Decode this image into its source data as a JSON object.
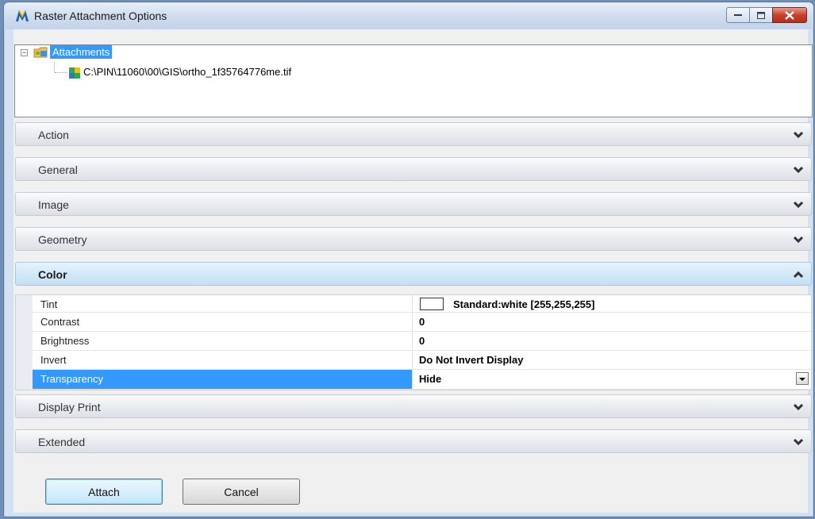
{
  "window": {
    "title": "Raster Attachment Options"
  },
  "tree": {
    "root_label": "Attachments",
    "expander": "−",
    "file_label": "C:\\PIN\\11060\\00\\GIS\\ortho_1f35764776me.tif"
  },
  "panels": {
    "action": "Action",
    "general": "General",
    "image": "Image",
    "geometry": "Geometry",
    "color": "Color",
    "display_print": "Display Print",
    "extended": "Extended"
  },
  "color_properties": [
    {
      "name": "Tint",
      "value": "Standard:white [255,255,255]"
    },
    {
      "name": "Contrast",
      "value": "0"
    },
    {
      "name": "Brightness",
      "value": "0"
    },
    {
      "name": "Invert",
      "value": "Do Not Invert Display"
    },
    {
      "name": "Transparency",
      "value": "Hide"
    }
  ],
  "buttons": {
    "attach": "Attach",
    "cancel": "Cancel"
  },
  "colors": {
    "selection": "#3399ff",
    "close_button": "#c7412c",
    "tint_swatch": "#ffffff"
  }
}
